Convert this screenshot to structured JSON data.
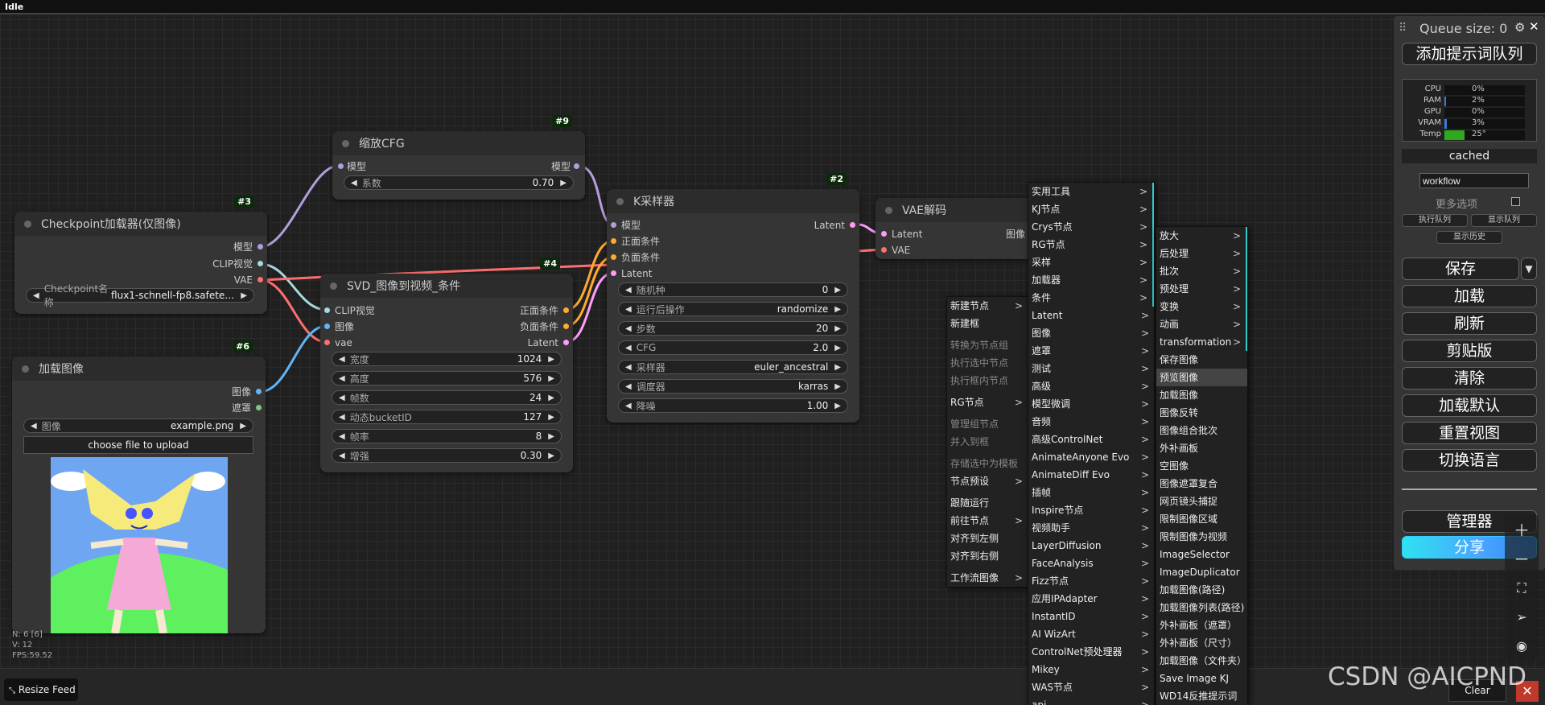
{
  "window": {
    "title": "Idle"
  },
  "nodes": {
    "scale_cfg": {
      "id": "#9",
      "title": "缩放CFG",
      "in_model": "模型",
      "out_model": "模型",
      "w_factor_label": "系数",
      "w_factor_value": "0.70"
    },
    "checkpoint": {
      "id": "#3",
      "title": "Checkpoint加载器(仅图像)",
      "out_model": "模型",
      "out_clip": "CLIP视觉",
      "out_vae": "VAE",
      "w_ckpt_label": "Checkpoint名称",
      "w_ckpt_value": "flux1-schnell-fp8.safete…"
    },
    "load_image": {
      "id": "#6",
      "title": "加载图像",
      "out_image": "图像",
      "out_mask": "遮罩",
      "w_image_label": "图像",
      "w_image_value": "example.png",
      "upload_label": "choose file to upload"
    },
    "svd": {
      "id": "#4",
      "title": "SVD_图像到视频_条件",
      "in_clip": "CLIP视觉",
      "in_image": "图像",
      "in_vae": "vae",
      "out_pos": "正面条件",
      "out_neg": "负面条件",
      "out_latent": "Latent",
      "widgets": [
        {
          "label": "宽度",
          "value": "1024"
        },
        {
          "label": "高度",
          "value": "576"
        },
        {
          "label": "帧数",
          "value": "24"
        },
        {
          "label": "动态bucketID",
          "value": "127"
        },
        {
          "label": "帧率",
          "value": "8"
        },
        {
          "label": "增强",
          "value": "0.30"
        }
      ]
    },
    "ksampler": {
      "id": "#2",
      "title": "K采样器",
      "in_model": "模型",
      "in_pos": "正面条件",
      "in_neg": "负面条件",
      "in_latent": "Latent",
      "out_latent": "Latent",
      "widgets": [
        {
          "label": "随机种",
          "value": "0"
        },
        {
          "label": "运行后操作",
          "value": "randomize"
        },
        {
          "label": "步数",
          "value": "20"
        },
        {
          "label": "CFG",
          "value": "2.0"
        },
        {
          "label": "采样器",
          "value": "euler_ancestral"
        },
        {
          "label": "调度器",
          "value": "karras"
        },
        {
          "label": "降噪",
          "value": "1.00"
        }
      ]
    },
    "vae_decode": {
      "title": "VAE解码",
      "in_latent": "Latent",
      "in_vae": "VAE",
      "out_image": "图像"
    }
  },
  "stats": {
    "n": "N: 6 [6]",
    "v": "V: 12",
    "fps": "FPS:59.52"
  },
  "bottom": {
    "resize_feed": "Resize Feed",
    "clear": "Clear",
    "watermark": "CSDN @AICPND"
  },
  "panel": {
    "queue_size": "Queue size: 0",
    "queue_prompt": "添加提示词队列",
    "monitors": [
      {
        "label": "CPU",
        "value": "0%",
        "fill": 0.0
      },
      {
        "label": "RAM",
        "value": "2%",
        "fill": 0.02
      },
      {
        "label": "GPU",
        "value": "0%",
        "fill": 0.0
      },
      {
        "label": "VRAM",
        "value": "3%",
        "fill": 0.03
      },
      {
        "label": "Temp",
        "value": "25°",
        "fill": 0.25
      }
    ],
    "cached": "cached",
    "workflow_input": "workflow",
    "more_options": "更多选项",
    "exec_queue": "执行队列",
    "show_queue": "显示队列",
    "show_history": "显示历史",
    "save": "保存",
    "load": "加载",
    "refresh": "刷新",
    "clipspace": "剪贴版",
    "clear": "清除",
    "load_default": "加载默认",
    "reset_view": "重置视图",
    "switch_lang": "切换语言",
    "manager": "管理器",
    "share": "分享"
  },
  "menu1": [
    {
      "label": "新建节点",
      "sub": true,
      "dis": false
    },
    {
      "label": "新建框",
      "sub": false,
      "dis": false
    },
    {
      "label": "转换为节点组",
      "sub": false,
      "dis": true
    },
    {
      "label": "执行选中节点",
      "sub": false,
      "dis": true
    },
    {
      "label": "执行框内节点",
      "sub": false,
      "dis": true
    },
    {
      "label": "RG节点",
      "sub": true,
      "dis": false
    },
    {
      "label": "管理组节点",
      "sub": false,
      "dis": true
    },
    {
      "label": "并入到框",
      "sub": false,
      "dis": true
    },
    {
      "label": "存储选中为模板",
      "sub": false,
      "dis": true
    },
    {
      "label": "节点预设",
      "sub": true,
      "dis": false
    },
    {
      "label": "跟随运行",
      "sub": false,
      "dis": false
    },
    {
      "label": "前往节点",
      "sub": true,
      "dis": false
    },
    {
      "label": "对齐到左侧",
      "sub": false,
      "dis": false
    },
    {
      "label": "对齐到右侧",
      "sub": false,
      "dis": false
    },
    {
      "label": "工作流图像",
      "sub": true,
      "dis": false
    }
  ],
  "menu2": [
    "实用工具",
    "KJ节点",
    "Crys节点",
    "RG节点",
    "采样",
    "加载器",
    "条件",
    "Latent",
    "图像",
    "遮罩",
    "测试",
    "高级",
    "模型微调",
    "音频",
    "高级ControlNet",
    "AnimateAnyone Evo",
    "AnimateDiff Evo",
    "插帧",
    "Inspire节点",
    "视频助手",
    "LayerDiffusion",
    "FaceAnalysis",
    "Fizz节点",
    "应用IPAdapter",
    "InstantID",
    "AI WizArt",
    "ControlNet预处理器",
    "Mikey",
    "WAS节点",
    "api"
  ],
  "menu3": [
    {
      "label": "放大",
      "sub": true
    },
    {
      "label": "后处理",
      "sub": true
    },
    {
      "label": "批次",
      "sub": true
    },
    {
      "label": "预处理",
      "sub": true
    },
    {
      "label": "变换",
      "sub": true
    },
    {
      "label": "动画",
      "sub": true
    },
    {
      "label": "transformation",
      "sub": true
    },
    {
      "label": "保存图像",
      "sub": false
    },
    {
      "label": "预览图像",
      "sub": false,
      "sel": true
    },
    {
      "label": "加载图像",
      "sub": false
    },
    {
      "label": "图像反转",
      "sub": false
    },
    {
      "label": "图像组合批次",
      "sub": false
    },
    {
      "label": "外补画板",
      "sub": false
    },
    {
      "label": "空图像",
      "sub": false
    },
    {
      "label": "图像遮罩复合",
      "sub": false
    },
    {
      "label": "网页镜头捕捉",
      "sub": false
    },
    {
      "label": "限制图像区域",
      "sub": false
    },
    {
      "label": "限制图像为视频",
      "sub": false
    },
    {
      "label": "ImageSelector",
      "sub": false
    },
    {
      "label": "ImageDuplicator",
      "sub": false
    },
    {
      "label": "加载图像(路径)",
      "sub": false
    },
    {
      "label": "加载图像列表(路径)",
      "sub": false
    },
    {
      "label": "外补画板（遮罩）",
      "sub": false
    },
    {
      "label": "外补画板（尺寸）",
      "sub": false
    },
    {
      "label": "加载图像（文件夹）",
      "sub": false
    },
    {
      "label": "Save Image KJ",
      "sub": false
    },
    {
      "label": "WD14反推提示词",
      "sub": false
    }
  ],
  "colors": {
    "model": "#b39ddb",
    "clip": "#a8dadc",
    "vae": "#ff6e6e",
    "image": "#64b5f6",
    "cond": "#ffa931",
    "latent": "#ff9cf9",
    "mask": "#81c784"
  }
}
